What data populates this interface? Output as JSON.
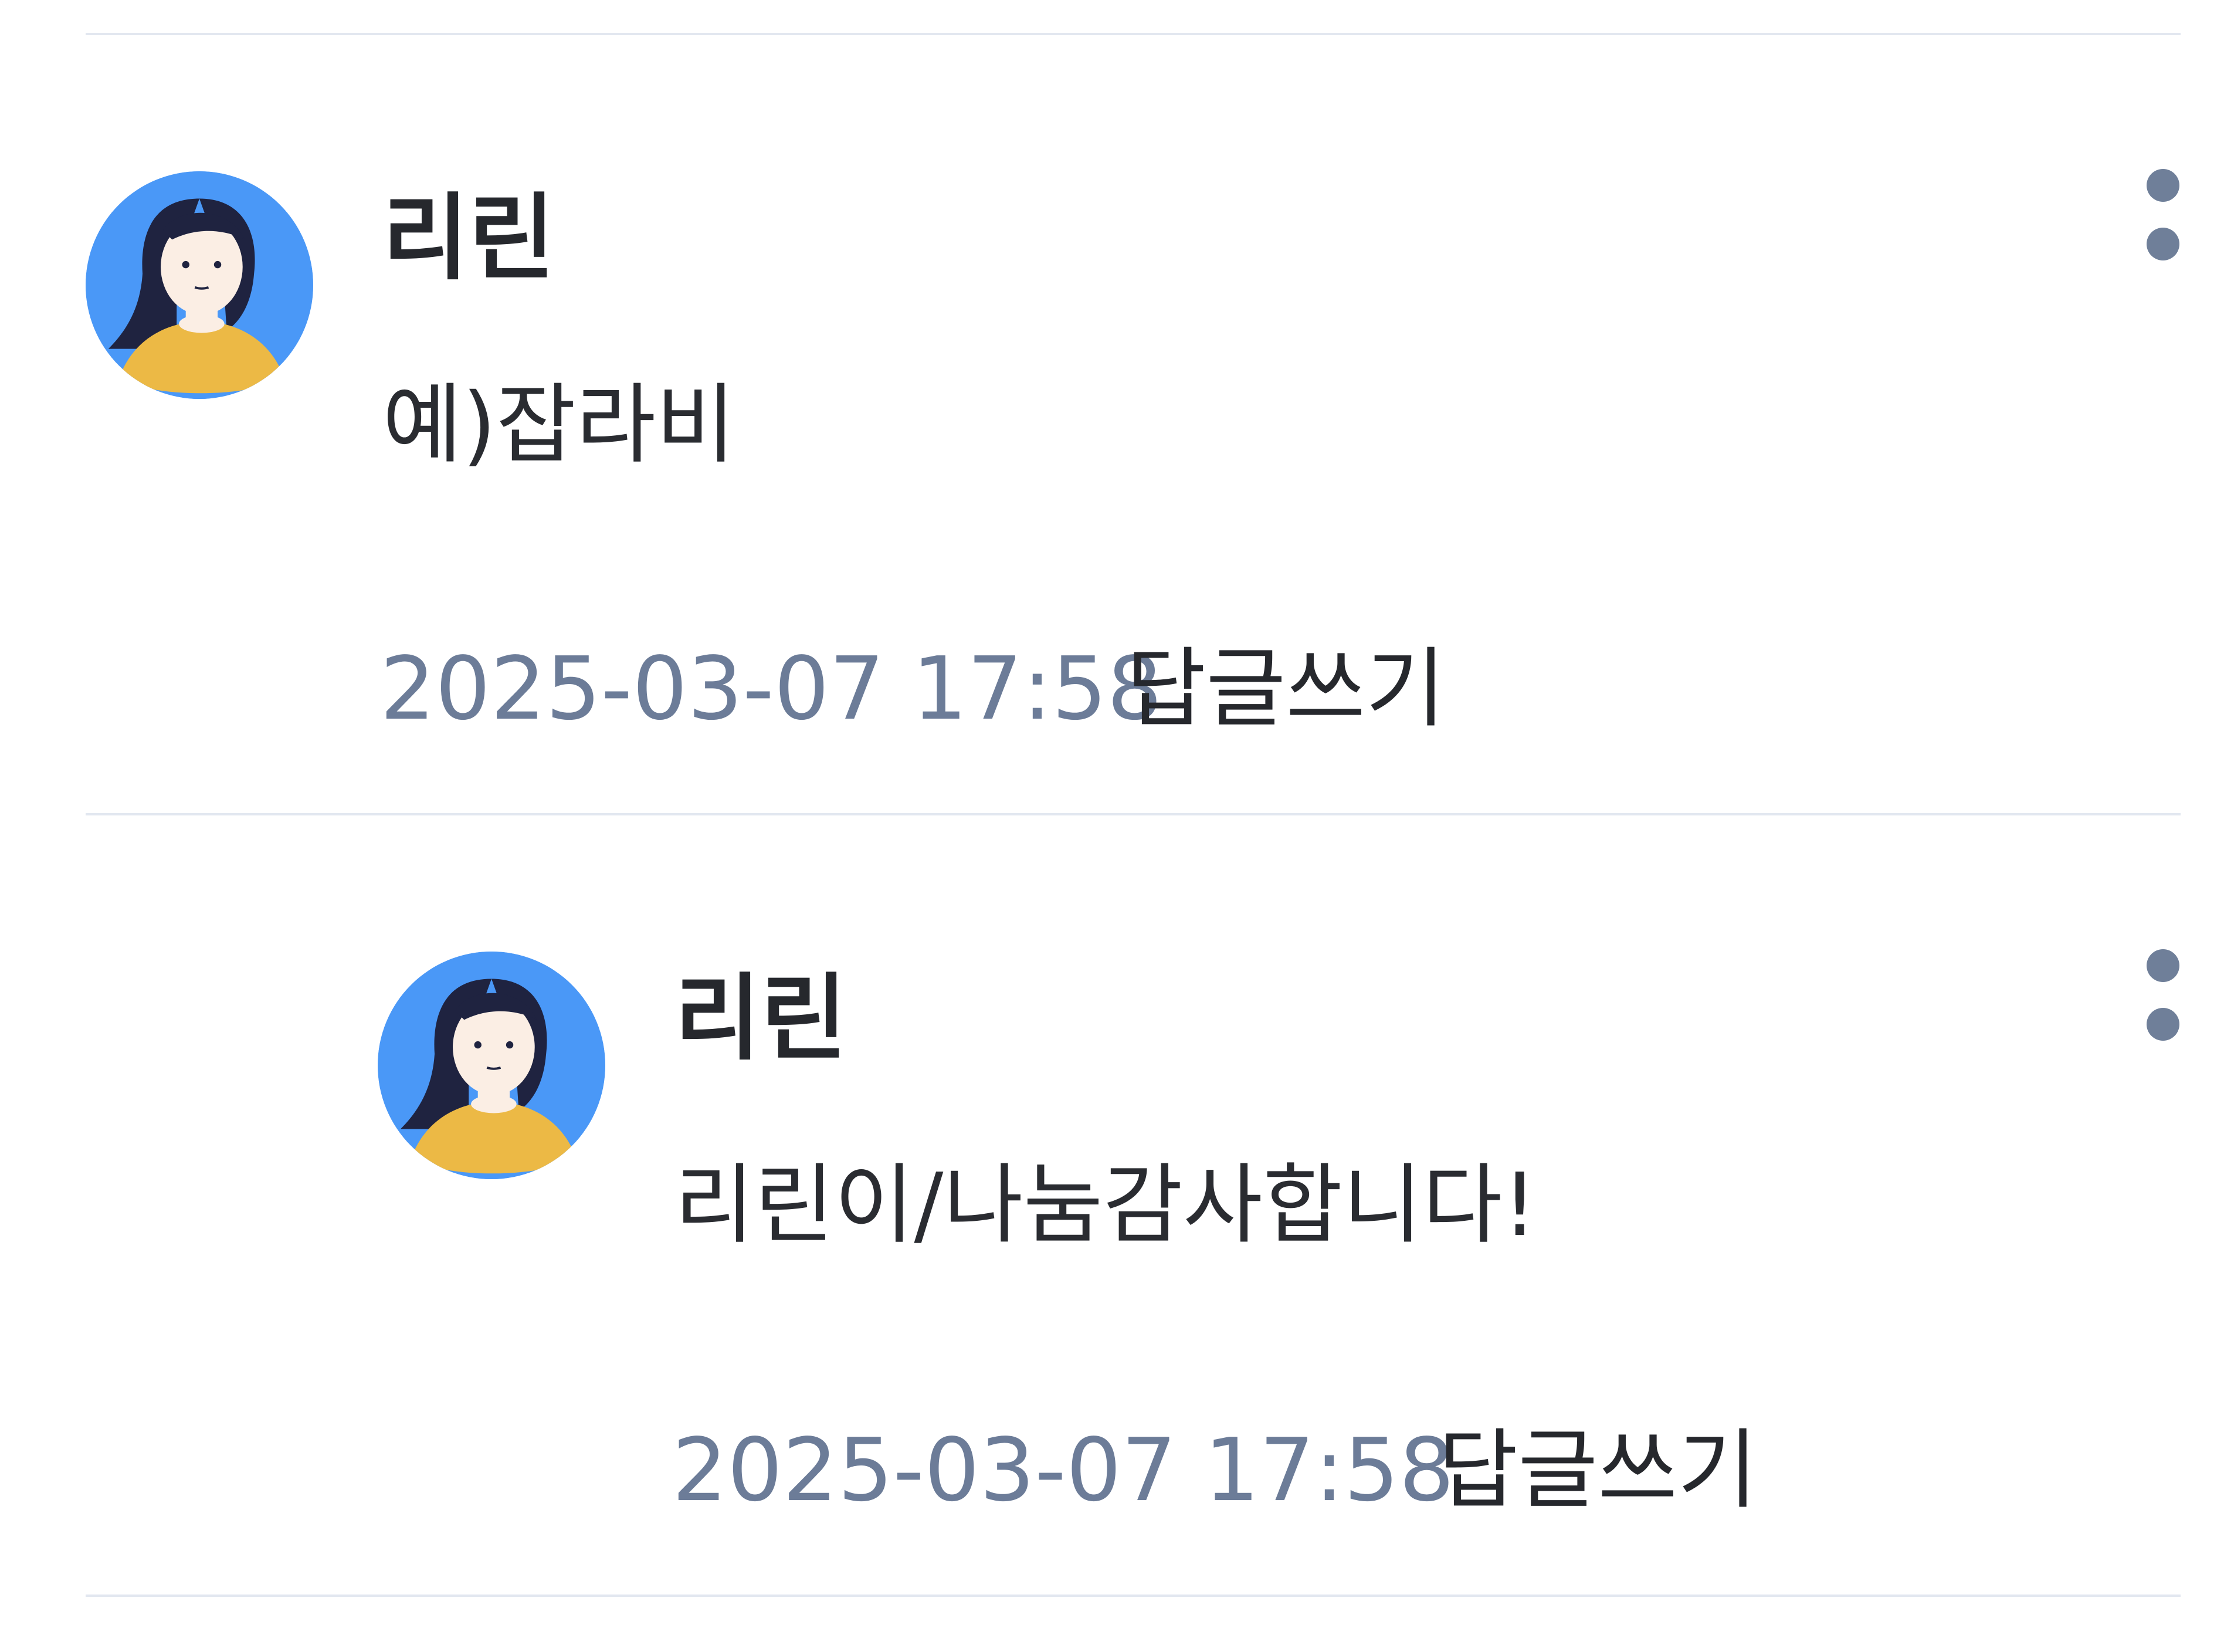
{
  "comments": [
    {
      "author": "리린",
      "content": "예)잡라비",
      "timestamp": "2025-03-07 17:58",
      "reply_label": "답글쓰기"
    },
    {
      "author": "리린",
      "content": "리린이/나눔감사합니다!",
      "timestamp": "2025-03-07 17:58",
      "reply_label": "답글쓰기"
    }
  ],
  "colors": {
    "avatar_background": "#4a98f7",
    "timestamp_text": "#6c7c98",
    "divider": "#e2e7f0"
  },
  "icons": {
    "avatar": "woman-avatar-icon",
    "more": "more-options-icon"
  }
}
